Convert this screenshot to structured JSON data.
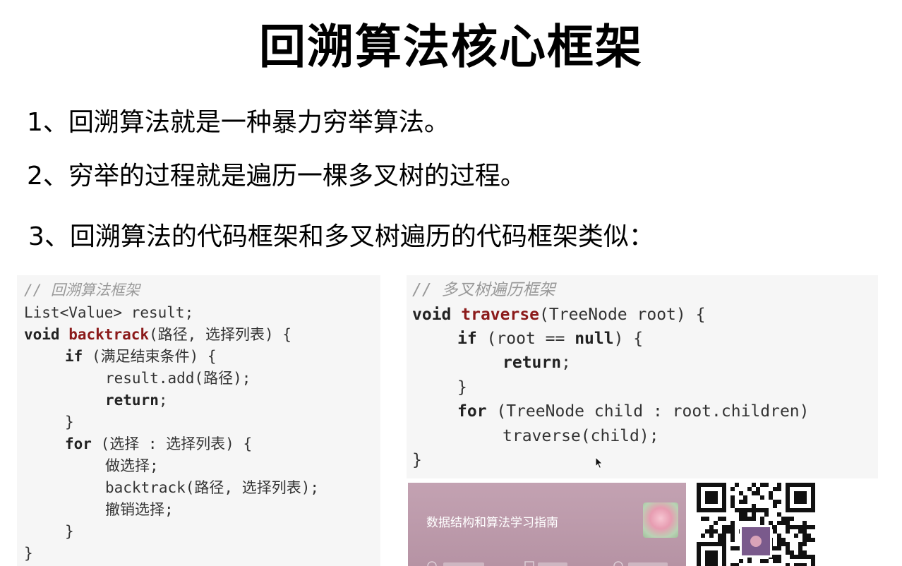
{
  "title": "回溯算法核心框架",
  "points": [
    "1、回溯算法就是一种暴力穷举算法。",
    "2、穷举的过程就是遍历一棵多叉树的过程。",
    "3、回溯算法的代码框架和多叉树遍历的代码框架类似："
  ],
  "code_backtrack": {
    "comment": "// 回溯算法框架",
    "l1": "List<Value> result;",
    "l2_kw": "void",
    "l2_fn": "backtrack",
    "l2_rest": "(路径, 选择列表) {",
    "l3_kw": "if",
    "l3_rest": " (满足结束条件) {",
    "l4": "result.add(路径);",
    "l5_kw": "return",
    "l5_rest": ";",
    "l6": "}",
    "l7_kw": "for",
    "l7_rest": " (选择 : 选择列表) {",
    "l8": "做选择;",
    "l9": "backtrack(路径, 选择列表);",
    "l10": "撤销选择;",
    "l11": "}",
    "l12": "}"
  },
  "code_traverse": {
    "comment": "// 多叉树遍历框架",
    "l1_kw": "void",
    "l1_fn": "traverse",
    "l1_rest": "(TreeNode root) {",
    "l2_kw": "if",
    "l2_mid": " (root == ",
    "l2_kw2": "null",
    "l2_rest": ") {",
    "l3_kw": "return",
    "l3_rest": ";",
    "l4": "}",
    "l5_kw": "for",
    "l5_rest": " (TreeNode child : root.children)",
    "l6": "traverse(child);",
    "l7": "}"
  },
  "card": {
    "title": "数据结构和算法学习指南"
  },
  "icons": {
    "cursor": "mouse-pointer-icon",
    "qr": "qr-code-icon",
    "thumb": "flower-thumbnail"
  }
}
